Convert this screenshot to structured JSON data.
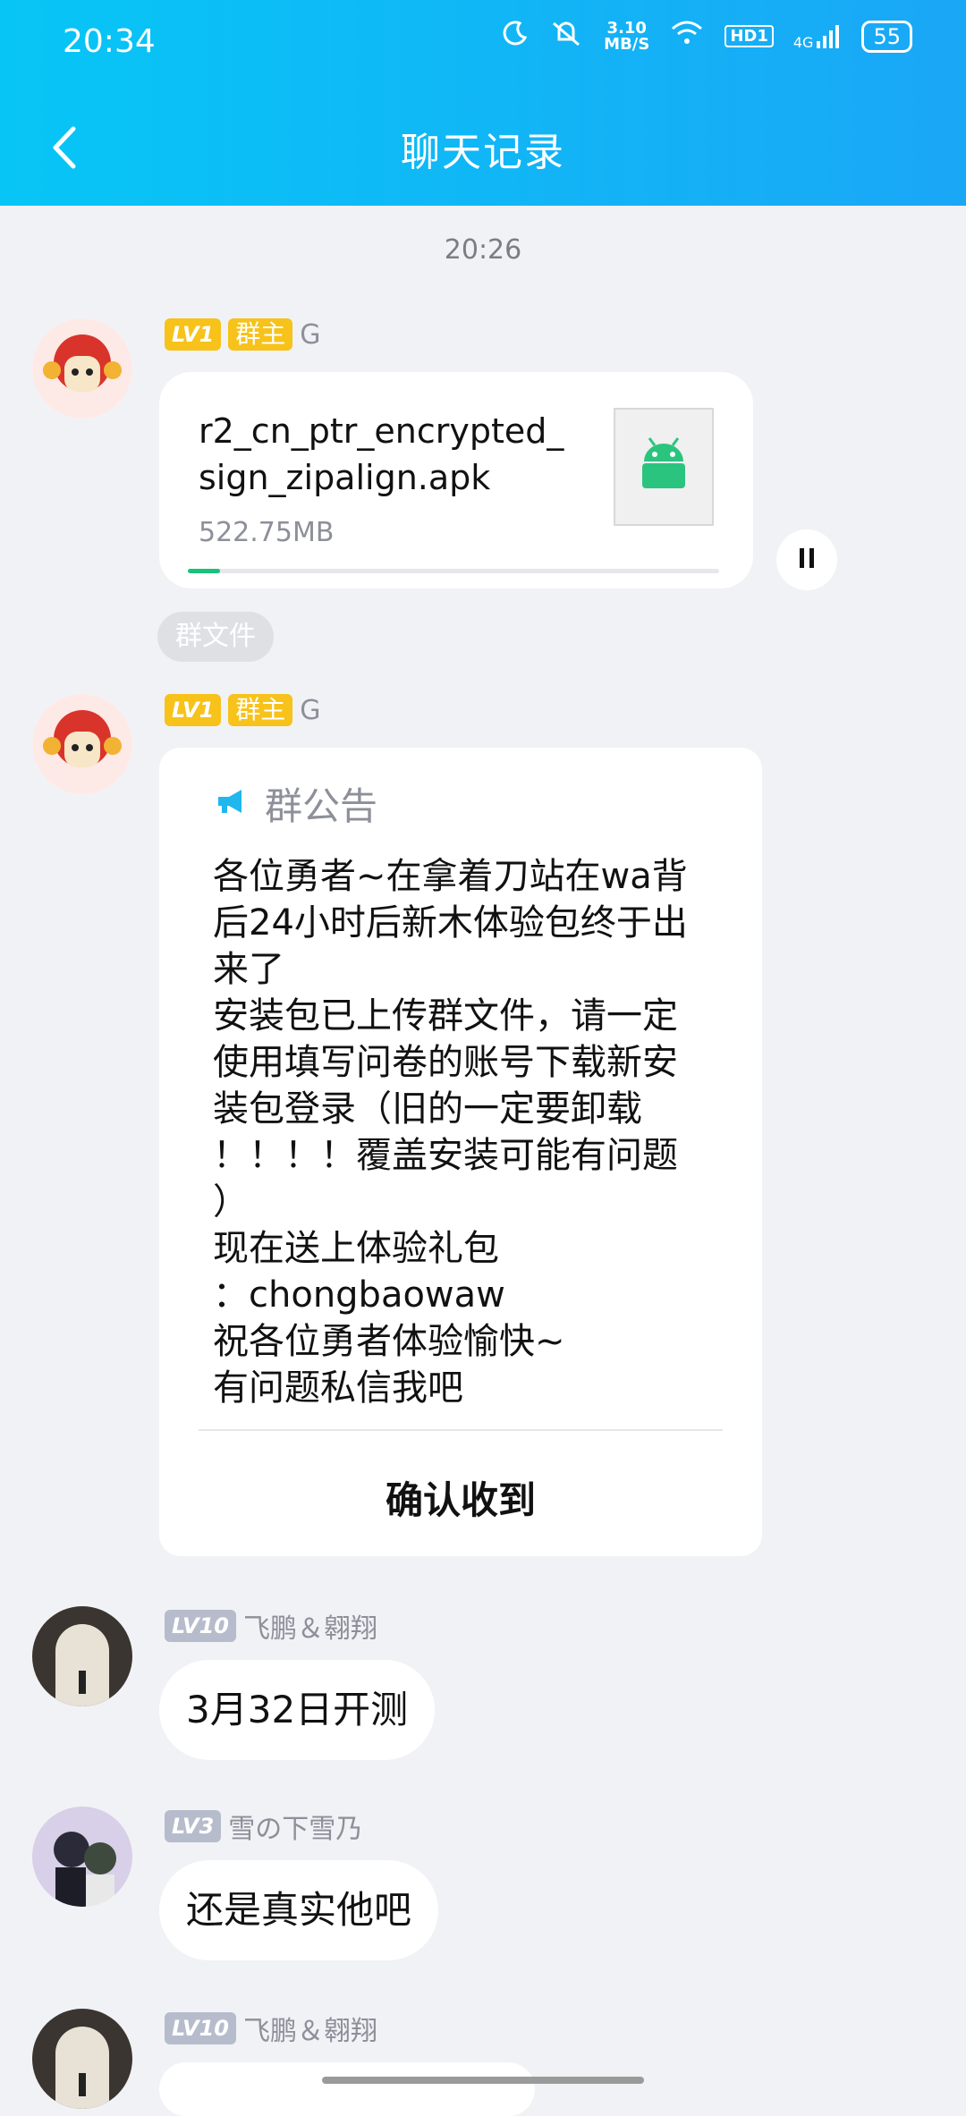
{
  "status": {
    "time": "20:34",
    "net_speed": "3.10\nMB/S",
    "net_speed_top": "3.10",
    "net_speed_bottom": "MB/S",
    "hd": "HD1",
    "network": "4G",
    "battery": "55"
  },
  "header": {
    "title": "聊天记录"
  },
  "chat": {
    "timestamp": "20:26",
    "file_msg": {
      "level": "LV1",
      "role": "群主",
      "sender": "G",
      "file_name": "r2_cn_ptr_encrypted_sign_zipalign.apk",
      "file_size": "522.75MB",
      "progress": 0.06,
      "tag": "群文件"
    },
    "notice_msg": {
      "level": "LV1",
      "role": "群主",
      "sender": "G",
      "header": "群公告",
      "lines": [
        "各位勇者~在拿着刀站在wa背",
        "后24小时后新木体验包终于出",
        "来了",
        "安装包已上传群文件，请一定",
        "使用填写问卷的账号下载新安",
        "装包登录（旧的一定要卸载",
        "！！！！覆盖安装可能有问题",
        "）",
        "现在送上体验礼包",
        "：chongbaowaw",
        "祝各位勇者体验愉快~",
        "有问题私信我吧"
      ],
      "confirm": "确认收到"
    },
    "msg3": {
      "level": "LV10",
      "sender": "飞鹏＆翱翔",
      "text": "3月32日开测"
    },
    "msg4": {
      "level": "LV3",
      "sender": "雪の下雪乃",
      "text": "还是真实他吧"
    },
    "msg5": {
      "level": "LV10",
      "sender": "飞鹏＆翱翔"
    }
  },
  "colors": {
    "header": "#07c6f6",
    "level_gold": "#f7c21a",
    "progress": "#18c27b"
  },
  "icons": [
    "back-arrow-icon",
    "moon-icon",
    "mute-icon",
    "wifi-icon",
    "signal-icon",
    "battery-icon",
    "android-apk-icon",
    "pause-icon",
    "megaphone-icon"
  ]
}
